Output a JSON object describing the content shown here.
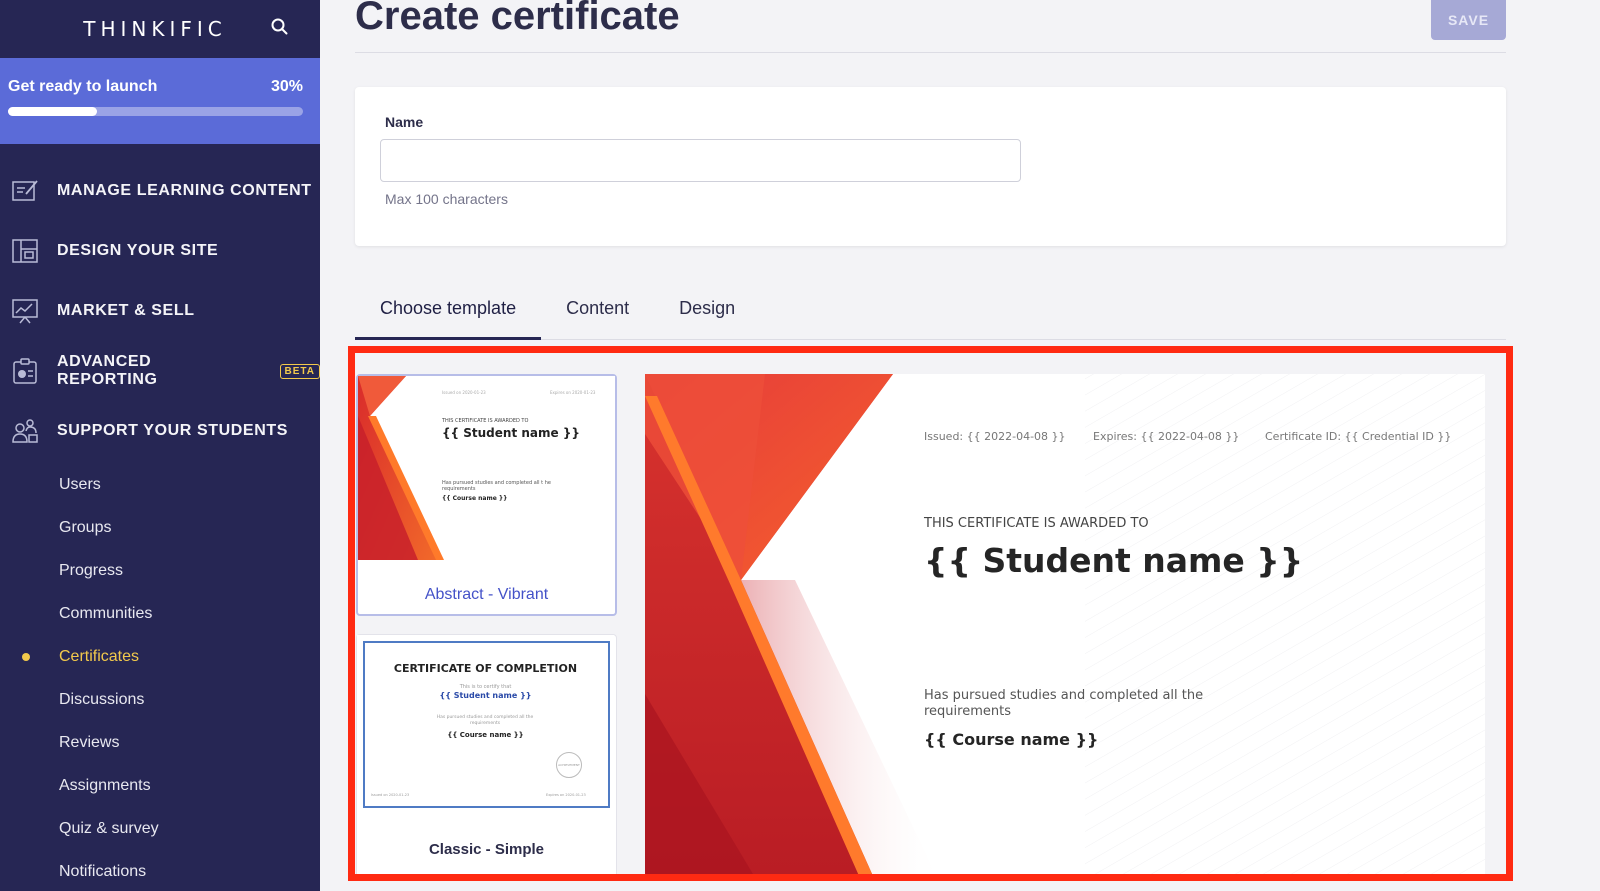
{
  "sidebar": {
    "brand": "THINKIFIC",
    "launch": {
      "label": "Get ready to launch",
      "percent_text": "30%",
      "progress": 0.3
    },
    "nav": [
      {
        "label": "MANAGE LEARNING CONTENT",
        "icon": "edit-content-icon"
      },
      {
        "label": "DESIGN YOUR SITE",
        "icon": "layout-icon"
      },
      {
        "label": "MARKET & SELL",
        "icon": "chart-board-icon"
      },
      {
        "label": "ADVANCED REPORTING",
        "icon": "report-icon",
        "badge": "BETA"
      },
      {
        "label": "SUPPORT YOUR STUDENTS",
        "icon": "students-icon"
      }
    ],
    "sub_items": [
      "Users",
      "Groups",
      "Progress",
      "Communities",
      "Certificates",
      "Discussions",
      "Reviews",
      "Assignments",
      "Quiz & survey",
      "Notifications"
    ],
    "active_sub": "Certificates"
  },
  "main": {
    "title": "Create certificate",
    "save_label": "SAVE",
    "name_field": {
      "label": "Name",
      "value": "",
      "hint": "Max 100 characters"
    },
    "tabs": [
      "Choose template",
      "Content",
      "Design"
    ],
    "active_tab": "Choose template"
  },
  "templates": [
    {
      "name": "Abstract - Vibrant",
      "issued": "Issued on 2020-01-23",
      "expires": "Expires on 2020-01-23",
      "awarded": "THIS CERTIFICATE IS AWARDED TO",
      "student": "{{ Student name }}",
      "pursued": "Has pursued studies and completed all t he requirements",
      "course": "{{ Course name }}"
    },
    {
      "name": "Classic - Simple",
      "heading": "CERTIFICATE OF COMPLETION",
      "certify": "This is to certify that",
      "student": "{{ Student name }}",
      "pursued": "Has pursued studies and completed all the requirements",
      "course": "{{ Course name }}",
      "seal": "ACHIEVEMENT",
      "issued": "Issued on 2020-01-23",
      "expires": "Expires on 2020-01-23"
    }
  ],
  "preview": {
    "issued": "Issued: {{ 2022-04-08 }}",
    "expires": "Expires: {{ 2022-04-08 }}",
    "cert_id": "Certificate ID: {{ Credential ID }}",
    "awarded": "THIS CERTIFICATE IS AWARDED TO",
    "student": "{{ Student name }}",
    "pursued": "Has pursued studies and completed all the requirements",
    "course": "{{ Course name }}"
  },
  "colors": {
    "sidebar": "#262654",
    "launch": "#5b6bd8",
    "accent": "#f2c94c",
    "highlight": "#ff2a12",
    "save": "#a6a9d6"
  }
}
